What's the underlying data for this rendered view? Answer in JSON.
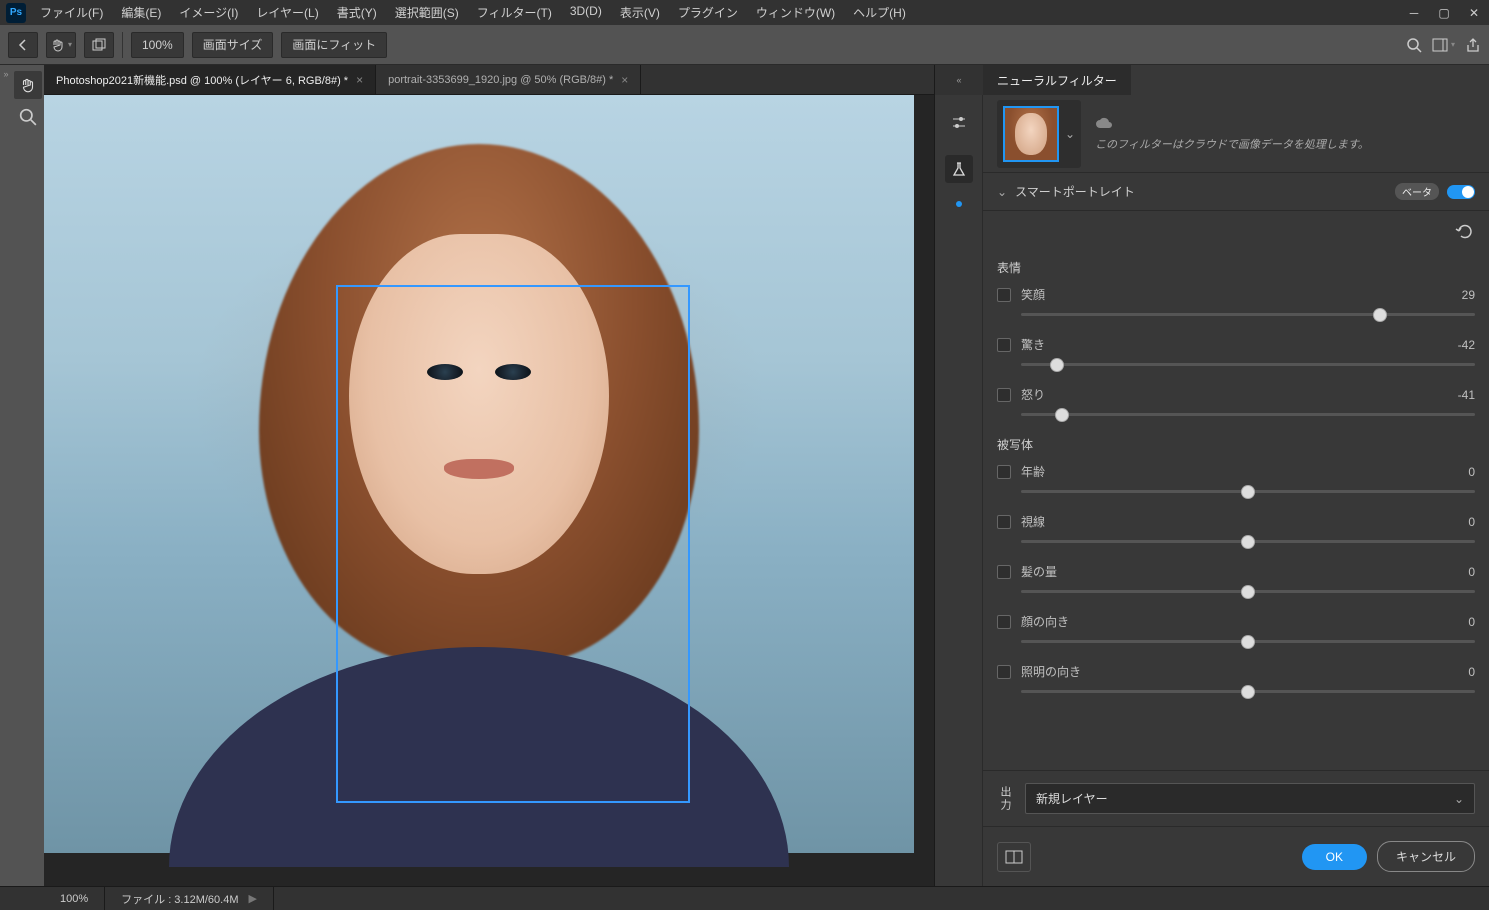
{
  "app": {
    "logo": "Ps"
  },
  "menu": [
    "ファイル(F)",
    "編集(E)",
    "イメージ(I)",
    "レイヤー(L)",
    "書式(Y)",
    "選択範囲(S)",
    "フィルター(T)",
    "3D(D)",
    "表示(V)",
    "プラグイン",
    "ウィンドウ(W)",
    "ヘルプ(H)"
  ],
  "options": {
    "zoom": "100%",
    "btn_fit_screen": "画面サイズ",
    "btn_fit": "画面にフィット"
  },
  "tabs": [
    {
      "label": "Photoshop2021新機能.psd @ 100% (レイヤー 6, RGB/8#) *",
      "active": true
    },
    {
      "label": "portrait-3353699_1920.jpg @ 50% (RGB/8#) *",
      "active": false
    }
  ],
  "panel": {
    "title": "ニューラルフィルター",
    "cloud_msg": "このフィルターはクラウドで画像データを処理します。",
    "filter_name": "スマートポートレイト",
    "badge": "ベータ",
    "groups": {
      "expression": "表情",
      "subject": "被写体"
    },
    "sliders": [
      {
        "group": "expression",
        "label": "笑顔",
        "value": 29,
        "pos": 79
      },
      {
        "group": "expression",
        "label": "驚き",
        "value": -42,
        "pos": 8
      },
      {
        "group": "expression",
        "label": "怒り",
        "value": -41,
        "pos": 9
      },
      {
        "group": "subject",
        "label": "年齢",
        "value": 0,
        "pos": 50
      },
      {
        "group": "subject",
        "label": "視線",
        "value": 0,
        "pos": 50
      },
      {
        "group": "subject",
        "label": "髪の量",
        "value": 0,
        "pos": 50
      },
      {
        "group": "subject",
        "label": "顔の向き",
        "value": 0,
        "pos": 50
      },
      {
        "group": "subject",
        "label": "照明の向き",
        "value": 0,
        "pos": 50
      }
    ],
    "output_label": "出力",
    "output_value": "新規レイヤー",
    "ok": "OK",
    "cancel": "キャンセル"
  },
  "status": {
    "zoom": "100%",
    "doc": "ファイル : 3.12M/60.4M"
  }
}
